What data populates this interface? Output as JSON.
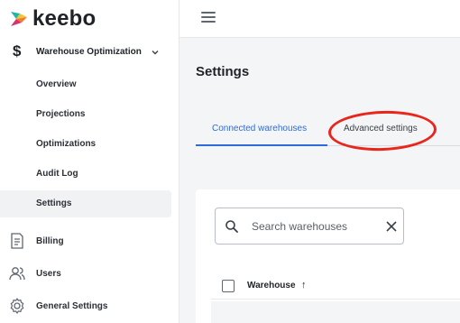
{
  "brand": {
    "name": "keebo",
    "colors": {
      "teal": "#1fb7a6",
      "yellow": "#f5c23c",
      "orange": "#ef7d2c",
      "magenta": "#d6336c"
    }
  },
  "sidebar": {
    "group": {
      "label": "Warehouse Optimization",
      "icon": "dollar-icon",
      "chevron": "chevron-down-icon",
      "dollar_glyph": "$"
    },
    "sub_items": [
      {
        "label": "Overview"
      },
      {
        "label": "Projections"
      },
      {
        "label": "Optimizations"
      },
      {
        "label": "Audit Log"
      },
      {
        "label": "Settings",
        "active": true
      }
    ],
    "nav_items": [
      {
        "label": "Billing",
        "icon": "billing-icon"
      },
      {
        "label": "Users",
        "icon": "users-icon"
      },
      {
        "label": "General Settings",
        "icon": "gear-icon"
      }
    ]
  },
  "topbar": {
    "menu_icon": "hamburger-menu-icon"
  },
  "main": {
    "title": "Settings",
    "tabs": [
      {
        "label": "Connected warehouses",
        "active": true
      },
      {
        "label": "Advanced settings",
        "active": false,
        "highlighted": true
      }
    ],
    "search": {
      "placeholder": "Search warehouses",
      "value": ""
    },
    "table": {
      "columns": [
        {
          "label": "Warehouse",
          "sort": "ascending",
          "sort_glyph": "↑"
        }
      ]
    }
  },
  "accent_color": "#2e6bd9",
  "annotation_color": "#e8261b"
}
